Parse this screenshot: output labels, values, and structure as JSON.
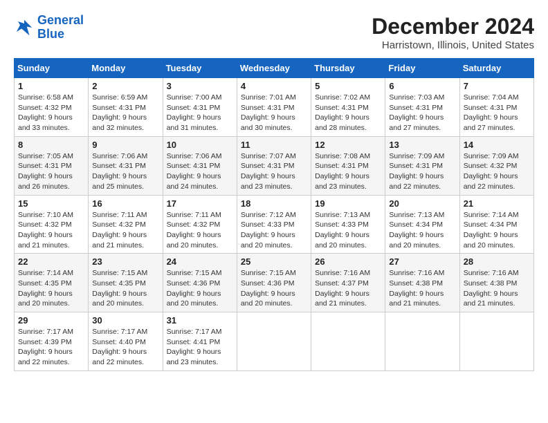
{
  "logo": {
    "line1": "General",
    "line2": "Blue"
  },
  "title": "December 2024",
  "subtitle": "Harristown, Illinois, United States",
  "days_of_week": [
    "Sunday",
    "Monday",
    "Tuesday",
    "Wednesday",
    "Thursday",
    "Friday",
    "Saturday"
  ],
  "weeks": [
    [
      {
        "day": "1",
        "info": "Sunrise: 6:58 AM\nSunset: 4:32 PM\nDaylight: 9 hours\nand 33 minutes."
      },
      {
        "day": "2",
        "info": "Sunrise: 6:59 AM\nSunset: 4:31 PM\nDaylight: 9 hours\nand 32 minutes."
      },
      {
        "day": "3",
        "info": "Sunrise: 7:00 AM\nSunset: 4:31 PM\nDaylight: 9 hours\nand 31 minutes."
      },
      {
        "day": "4",
        "info": "Sunrise: 7:01 AM\nSunset: 4:31 PM\nDaylight: 9 hours\nand 30 minutes."
      },
      {
        "day": "5",
        "info": "Sunrise: 7:02 AM\nSunset: 4:31 PM\nDaylight: 9 hours\nand 28 minutes."
      },
      {
        "day": "6",
        "info": "Sunrise: 7:03 AM\nSunset: 4:31 PM\nDaylight: 9 hours\nand 27 minutes."
      },
      {
        "day": "7",
        "info": "Sunrise: 7:04 AM\nSunset: 4:31 PM\nDaylight: 9 hours\nand 27 minutes."
      }
    ],
    [
      {
        "day": "8",
        "info": "Sunrise: 7:05 AM\nSunset: 4:31 PM\nDaylight: 9 hours\nand 26 minutes."
      },
      {
        "day": "9",
        "info": "Sunrise: 7:06 AM\nSunset: 4:31 PM\nDaylight: 9 hours\nand 25 minutes."
      },
      {
        "day": "10",
        "info": "Sunrise: 7:06 AM\nSunset: 4:31 PM\nDaylight: 9 hours\nand 24 minutes."
      },
      {
        "day": "11",
        "info": "Sunrise: 7:07 AM\nSunset: 4:31 PM\nDaylight: 9 hours\nand 23 minutes."
      },
      {
        "day": "12",
        "info": "Sunrise: 7:08 AM\nSunset: 4:31 PM\nDaylight: 9 hours\nand 23 minutes."
      },
      {
        "day": "13",
        "info": "Sunrise: 7:09 AM\nSunset: 4:31 PM\nDaylight: 9 hours\nand 22 minutes."
      },
      {
        "day": "14",
        "info": "Sunrise: 7:09 AM\nSunset: 4:32 PM\nDaylight: 9 hours\nand 22 minutes."
      }
    ],
    [
      {
        "day": "15",
        "info": "Sunrise: 7:10 AM\nSunset: 4:32 PM\nDaylight: 9 hours\nand 21 minutes."
      },
      {
        "day": "16",
        "info": "Sunrise: 7:11 AM\nSunset: 4:32 PM\nDaylight: 9 hours\nand 21 minutes."
      },
      {
        "day": "17",
        "info": "Sunrise: 7:11 AM\nSunset: 4:32 PM\nDaylight: 9 hours\nand 20 minutes."
      },
      {
        "day": "18",
        "info": "Sunrise: 7:12 AM\nSunset: 4:33 PM\nDaylight: 9 hours\nand 20 minutes."
      },
      {
        "day": "19",
        "info": "Sunrise: 7:13 AM\nSunset: 4:33 PM\nDaylight: 9 hours\nand 20 minutes."
      },
      {
        "day": "20",
        "info": "Sunrise: 7:13 AM\nSunset: 4:34 PM\nDaylight: 9 hours\nand 20 minutes."
      },
      {
        "day": "21",
        "info": "Sunrise: 7:14 AM\nSunset: 4:34 PM\nDaylight: 9 hours\nand 20 minutes."
      }
    ],
    [
      {
        "day": "22",
        "info": "Sunrise: 7:14 AM\nSunset: 4:35 PM\nDaylight: 9 hours\nand 20 minutes."
      },
      {
        "day": "23",
        "info": "Sunrise: 7:15 AM\nSunset: 4:35 PM\nDaylight: 9 hours\nand 20 minutes."
      },
      {
        "day": "24",
        "info": "Sunrise: 7:15 AM\nSunset: 4:36 PM\nDaylight: 9 hours\nand 20 minutes."
      },
      {
        "day": "25",
        "info": "Sunrise: 7:15 AM\nSunset: 4:36 PM\nDaylight: 9 hours\nand 20 minutes."
      },
      {
        "day": "26",
        "info": "Sunrise: 7:16 AM\nSunset: 4:37 PM\nDaylight: 9 hours\nand 21 minutes."
      },
      {
        "day": "27",
        "info": "Sunrise: 7:16 AM\nSunset: 4:38 PM\nDaylight: 9 hours\nand 21 minutes."
      },
      {
        "day": "28",
        "info": "Sunrise: 7:16 AM\nSunset: 4:38 PM\nDaylight: 9 hours\nand 21 minutes."
      }
    ],
    [
      {
        "day": "29",
        "info": "Sunrise: 7:17 AM\nSunset: 4:39 PM\nDaylight: 9 hours\nand 22 minutes."
      },
      {
        "day": "30",
        "info": "Sunrise: 7:17 AM\nSunset: 4:40 PM\nDaylight: 9 hours\nand 22 minutes."
      },
      {
        "day": "31",
        "info": "Sunrise: 7:17 AM\nSunset: 4:41 PM\nDaylight: 9 hours\nand 23 minutes."
      },
      null,
      null,
      null,
      null
    ]
  ]
}
